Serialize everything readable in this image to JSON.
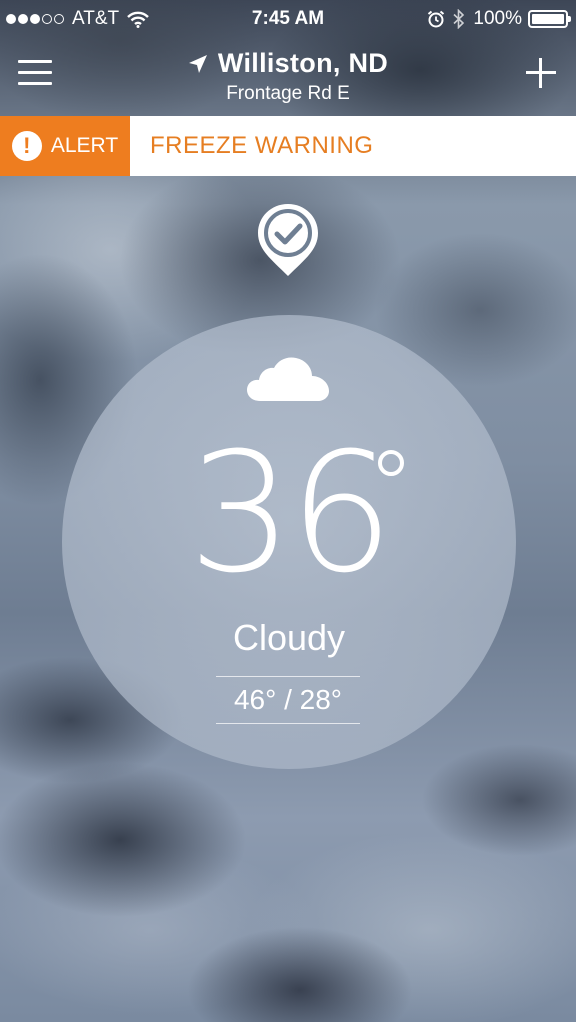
{
  "status_bar": {
    "carrier": "AT&T",
    "time": "7:45 AM",
    "battery_percent": "100%",
    "signal_strength": 3,
    "signal_max": 5
  },
  "header": {
    "city": "Williston, ND",
    "street": "Frontage Rd E"
  },
  "alert": {
    "tag_label": "ALERT",
    "message": "FREEZE WARNING",
    "accent_color": "#ee7d1f"
  },
  "current": {
    "temperature": "36",
    "condition": "Cloudy",
    "hi_lo": "46° / 28°"
  },
  "icons": {
    "menu": "hamburger-menu-icon",
    "location": "location-arrow-icon",
    "add": "plus-icon",
    "alert": "exclamation-icon",
    "check": "check-pin-icon",
    "weather": "cloud-icon",
    "wifi": "wifi-icon",
    "alarm": "alarm-clock-icon",
    "bluetooth": "bluetooth-icon"
  }
}
